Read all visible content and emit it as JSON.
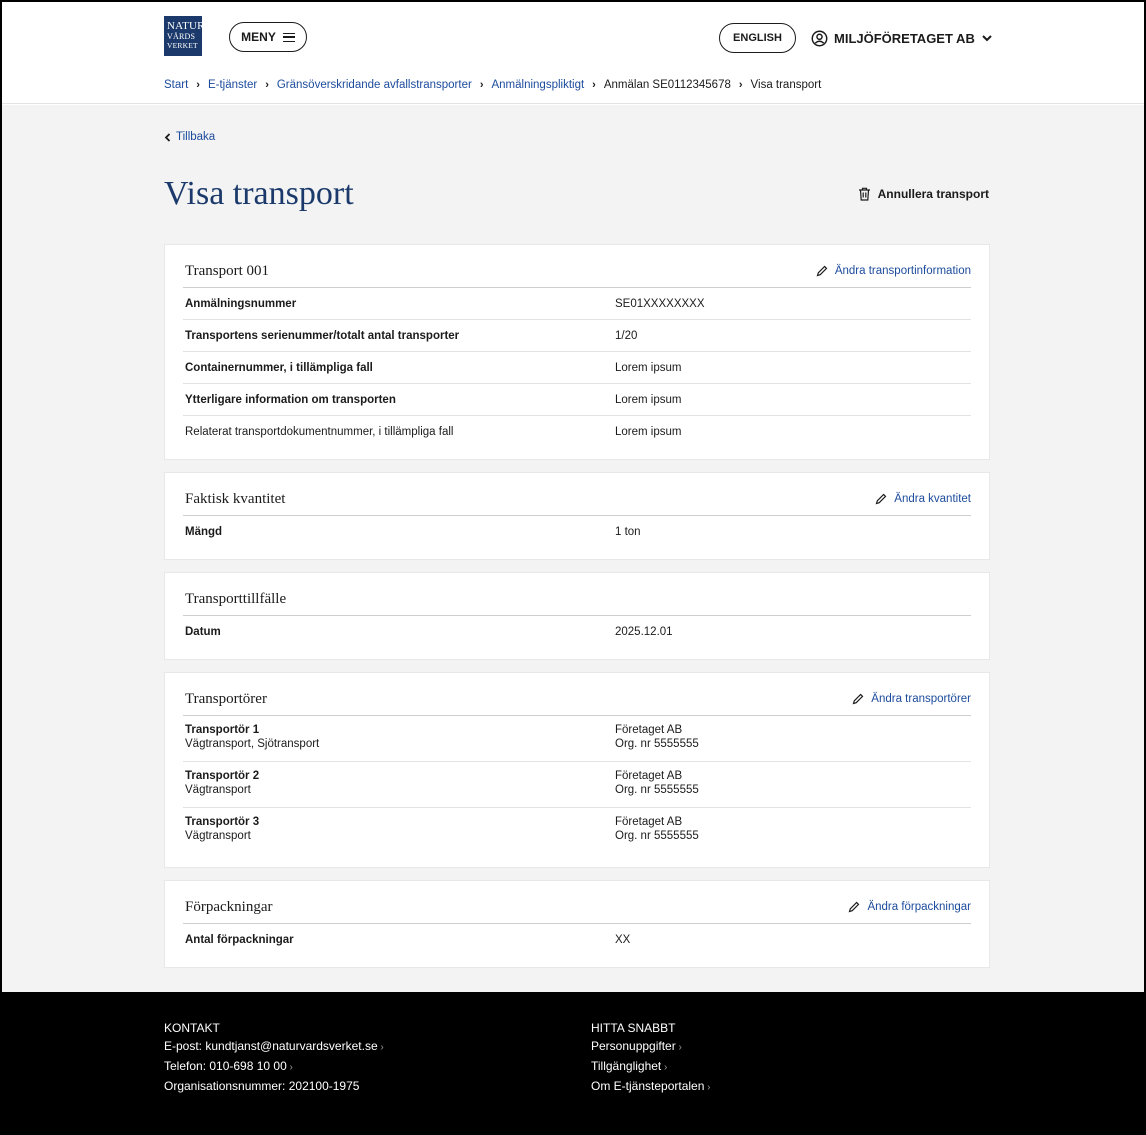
{
  "header": {
    "logo": {
      "line1": "NATUR",
      "line2": "VÅRDS",
      "line3": "VERKET"
    },
    "menu_label": "MENY",
    "language_label": "ENGLISH",
    "user_label": "MILJÖFÖRETAGET AB"
  },
  "breadcrumb": {
    "items": [
      "Start",
      "E-tjänster",
      "Gränsöverskridande avfallstransporter",
      "Anmälningspliktigt"
    ],
    "notice": "Anmälan SE0112345678",
    "current": "Visa transport"
  },
  "page": {
    "back_label": "Tillbaka",
    "title": "Visa transport",
    "cancel_label": "Annullera transport"
  },
  "transport": {
    "title": "Transport 001",
    "edit_label": "Ändra transportinformation",
    "rows": [
      {
        "label": "Anmälningsnummer",
        "value": "SE01XXXXXXXX"
      },
      {
        "label": "Transportens serienummer/totalt antal transporter",
        "value": "1/20"
      },
      {
        "label": "Containernummer, i tillämpliga fall",
        "value": "Lorem ipsum"
      },
      {
        "label": "Ytterligare information om transporten",
        "value": "Lorem ipsum"
      },
      {
        "label": "Relaterat transportdokumentnummer, i tillämpliga fall",
        "value": "Lorem ipsum"
      }
    ]
  },
  "quantity": {
    "title": "Faktisk kvantitet",
    "edit_label": "Ändra kvantitet",
    "rows": [
      {
        "label": "Mängd",
        "value": "1 ton"
      }
    ]
  },
  "occasion": {
    "title": "Transporttillfälle",
    "rows": [
      {
        "label": "Datum",
        "value": "2025.12.01"
      }
    ]
  },
  "carriers": {
    "title": "Transportörer",
    "edit_label": "Ändra transportörer",
    "rows": [
      {
        "label": "Transportör 1",
        "sub": "Vägtransport, Sjötransport",
        "company": "Företaget AB",
        "org": "Org. nr 5555555"
      },
      {
        "label": "Transportör 2",
        "sub": "Vägtransport",
        "company": "Företaget AB",
        "org": "Org. nr 5555555"
      },
      {
        "label": "Transportör 3",
        "sub": "Vägtransport",
        "company": "Företaget AB",
        "org": "Org. nr 5555555"
      }
    ]
  },
  "packaging": {
    "title": "Förpackningar",
    "edit_label": "Ändra förpackningar",
    "rows": [
      {
        "label": "Antal förpackningar",
        "value": "XX"
      }
    ]
  },
  "footer": {
    "contact_heading": "KONTAKT",
    "contact_links": [
      "E-post: kundtjanst@naturvardsverket.se",
      "Telefon: 010-698 10 00"
    ],
    "org_number": "Organisationsnummer: 202100-1975",
    "quick_heading": "HITTA SNABBT",
    "quick_links": [
      "Personuppgifter",
      "Tillgänglighet",
      "Om E-tjänsteportalen"
    ]
  },
  "colors": {
    "brand": "#1b3a6b",
    "link": "#1c4b9c",
    "background": "#f3f3f3",
    "footer": "#000000"
  }
}
